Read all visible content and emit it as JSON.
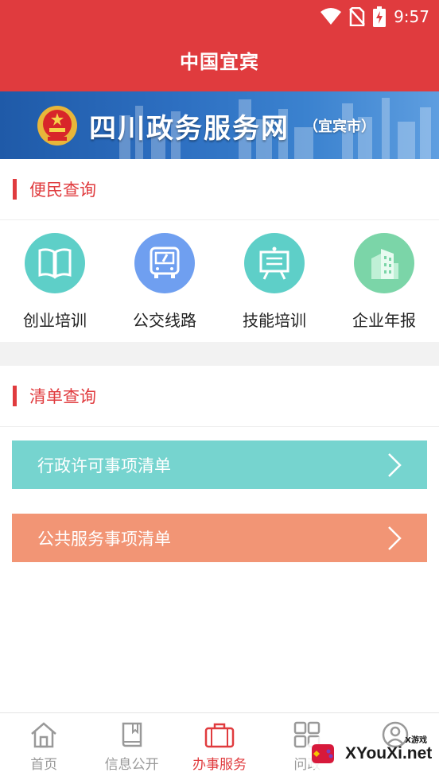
{
  "status_bar": {
    "time": "9:57",
    "icons": [
      "wifi-icon",
      "no-sim-icon",
      "battery-charging-icon"
    ]
  },
  "header": {
    "title": "中国宜宾"
  },
  "banner": {
    "name": "四川政务服务网",
    "city": "（宜宾市）"
  },
  "convenience": {
    "title": "便民查询",
    "items": [
      {
        "label": "创业培训",
        "icon": "book-icon",
        "color": "#5ecfc8"
      },
      {
        "label": "公交线路",
        "icon": "bus-icon",
        "color": "#6f9ff0"
      },
      {
        "label": "技能培训",
        "icon": "easel-icon",
        "color": "#5ecfc8"
      },
      {
        "label": "企业年报",
        "icon": "building-icon",
        "color": "#7bd5a8"
      }
    ]
  },
  "list_query": {
    "title": "清单查询",
    "buttons": [
      {
        "label": "行政许可事项清单",
        "color": "#76d4cf"
      },
      {
        "label": "公共服务事项清单",
        "color": "#f29575"
      }
    ]
  },
  "tabbar": {
    "tabs": [
      {
        "label": "首页",
        "icon": "home-icon",
        "active": false
      },
      {
        "label": "信息公开",
        "icon": "book-icon",
        "active": false
      },
      {
        "label": "办事服务",
        "icon": "briefcase-icon",
        "active": true
      },
      {
        "label": "问政",
        "icon": "grid-icon",
        "active": false
      },
      {
        "label": "",
        "icon": "user-icon",
        "active": false
      }
    ]
  },
  "watermark": {
    "text": "XYouXi.net",
    "small": "X游戏"
  },
  "colors": {
    "brand_red": "#e03b3e"
  }
}
